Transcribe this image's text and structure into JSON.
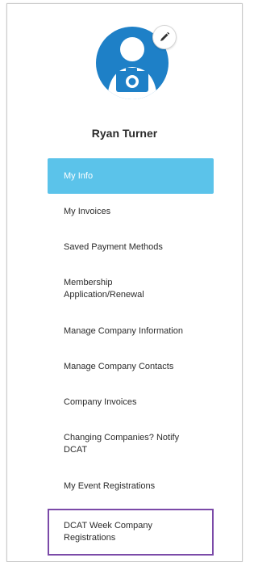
{
  "profile": {
    "name": "Ryan Turner",
    "avatar_icon": "camera-user-icon",
    "edit_icon": "pencil-icon"
  },
  "menu": {
    "items": [
      {
        "label": "My Info",
        "active": true
      },
      {
        "label": "My Invoices"
      },
      {
        "label": "Saved Payment Methods"
      },
      {
        "label": "Membership Application/Renewal"
      },
      {
        "label": "Manage Company Information"
      },
      {
        "label": "Manage Company Contacts"
      },
      {
        "label": "Company Invoices"
      },
      {
        "label": "Changing Companies? Notify DCAT"
      },
      {
        "label": "My Event Registrations"
      },
      {
        "label": "DCAT Week Company Registrations",
        "highlighted": true
      }
    ]
  },
  "colors": {
    "active_bg": "#5bc3ea",
    "avatar_bg": "#1e80c7",
    "highlight_border": "#7b4aa8"
  }
}
